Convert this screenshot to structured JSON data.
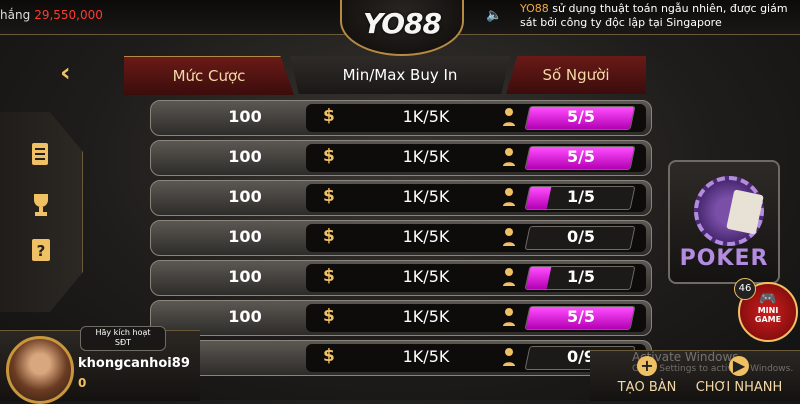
{
  "topbar": {
    "jackpot_label": "hắng",
    "jackpot_amount": "29,550,000",
    "logo_text": "YO88",
    "notice_brand": "YO88",
    "notice_text": " sử dụng thuật toán ngẫu nhiên, được giám sát bởi công ty độc lập tại Singapore"
  },
  "header": {
    "bet_label": "Mức Cược",
    "buyin_label": "Min/Max Buy In",
    "players_label": "Số Người"
  },
  "rows": [
    {
      "bet": "100",
      "currency_icon": "$",
      "buyin": "1K/5K",
      "players": "5/5",
      "fill": 1.0
    },
    {
      "bet": "100",
      "currency_icon": "$",
      "buyin": "1K/5K",
      "players": "5/5",
      "fill": 1.0
    },
    {
      "bet": "100",
      "currency_icon": "$",
      "buyin": "1K/5K",
      "players": "1/5",
      "fill": 0.2
    },
    {
      "bet": "100",
      "currency_icon": "$",
      "buyin": "1K/5K",
      "players": "0/5",
      "fill": 0.0
    },
    {
      "bet": "100",
      "currency_icon": "$",
      "buyin": "1K/5K",
      "players": "1/5",
      "fill": 0.2
    },
    {
      "bet": "100",
      "currency_icon": "$",
      "buyin": "1K/5K",
      "players": "5/5",
      "fill": 1.0
    },
    {
      "bet": "",
      "currency_icon": "$",
      "buyin": "1K/5K",
      "players": "0/9",
      "fill": 0.0
    }
  ],
  "poker": {
    "label": "POKER"
  },
  "mini_game": {
    "badge": "46",
    "label_line1": "MINI",
    "label_line2": "GAME"
  },
  "user": {
    "activate_line1": "Hãy kích hoạt",
    "activate_line2": "SĐT",
    "username": "khongcanhoi89",
    "balance": "0"
  },
  "watermark": {
    "line1": "Activate Windows",
    "line2": "Go to Settings to activate Windows."
  },
  "bottom": {
    "create_label": "TẠO BÀN",
    "create_icon": "+",
    "quick_label": "CHƠI NHANH",
    "quick_icon": "▶"
  },
  "colors": {
    "accent": "#f0c064",
    "progress": "#ff4dff",
    "header_red": "#6a1a17",
    "jackpot": "#ff3b30"
  },
  "icons": [
    "back-chevron-icon",
    "document-icon",
    "trophy-icon",
    "help-icon",
    "speaker-icon",
    "person-icon",
    "dollar-icon"
  ]
}
